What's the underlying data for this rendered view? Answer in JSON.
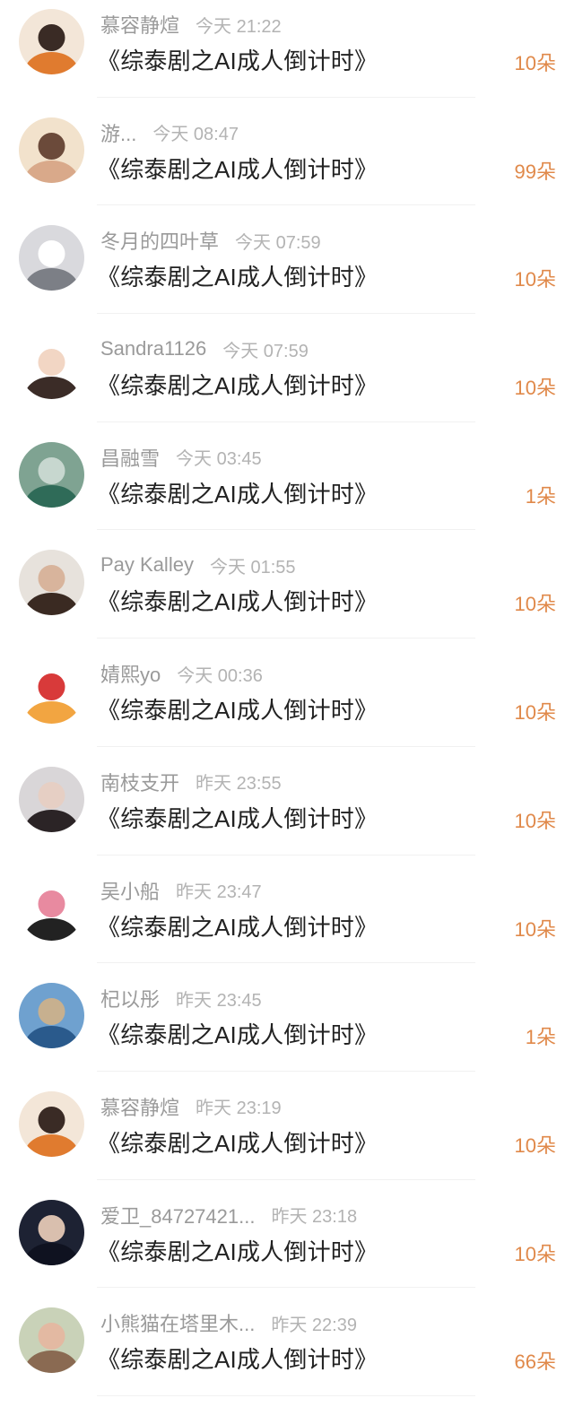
{
  "entries": [
    {
      "name": "慕容静煊",
      "time": "今天 21:22",
      "title": "《综泰剧之AI成人倒计时》",
      "amount": "10朵",
      "avatar_icon": "girl-in-orange-avatar-icon",
      "avatar_colors": [
        "#f3e6d8",
        "#e07b2f",
        "#3a2b25"
      ]
    },
    {
      "name": "游...",
      "time": "今天 08:47",
      "title": "《综泰剧之AI成人倒计时》",
      "amount": "99朵",
      "avatar_icon": "girl-portrait-avatar-icon",
      "avatar_colors": [
        "#f2e2cc",
        "#d9a98a",
        "#6b4a3a"
      ]
    },
    {
      "name": "冬月的四叶草",
      "time": "今天 07:59",
      "title": "《综泰剧之AI成人倒计时》",
      "amount": "10朵",
      "avatar_icon": "cat-avatar-icon",
      "avatar_colors": [
        "#d9d9dd",
        "#7c7f86",
        "#ffffff"
      ]
    },
    {
      "name": "Sandra1126",
      "time": "今天 07:59",
      "title": "《综泰剧之AI成人倒计时》",
      "amount": "10朵",
      "avatar_icon": "cartoon-boy-avatar-icon",
      "avatar_colors": [
        "#ffffff",
        "#3b2c27",
        "#f2d6c4"
      ]
    },
    {
      "name": "昌融雪",
      "time": "今天 03:45",
      "title": "《综泰剧之AI成人倒计时》",
      "amount": "1朵",
      "avatar_icon": "lake-landscape-avatar-icon",
      "avatar_colors": [
        "#7fa392",
        "#2f6b58",
        "#c7d7cf"
      ]
    },
    {
      "name": "Pay Kalley",
      "time": "今天 01:55",
      "title": "《综泰剧之AI成人倒计时》",
      "amount": "10朵",
      "avatar_icon": "girl-photo-avatar-icon",
      "avatar_colors": [
        "#e7e2dc",
        "#3a2a22",
        "#d8b49c"
      ]
    },
    {
      "name": "婧熙yo",
      "time": "今天 00:36",
      "title": "《综泰剧之AI成人倒计时》",
      "amount": "10朵",
      "avatar_icon": "cartoon-dragon-avatar-icon",
      "avatar_colors": [
        "#ffffff",
        "#f2a541",
        "#d83a3a"
      ]
    },
    {
      "name": "南枝支开",
      "time": "昨天 23:55",
      "title": "《综泰剧之AI成人倒计时》",
      "amount": "10朵",
      "avatar_icon": "man-portrait-avatar-icon",
      "avatar_colors": [
        "#d9d6d8",
        "#2b2426",
        "#e6cfc4"
      ]
    },
    {
      "name": "吴小船",
      "time": "昨天 23:47",
      "title": "《综泰剧之AI成人倒计时》",
      "amount": "10朵",
      "avatar_icon": "cartoon-character-avatar-icon",
      "avatar_colors": [
        "#ffffff",
        "#222222",
        "#e88aa0"
      ]
    },
    {
      "name": "杞以彤",
      "time": "昨天 23:45",
      "title": "《综泰剧之AI成人倒计时》",
      "amount": "1朵",
      "avatar_icon": "mountain-lake-avatar-icon",
      "avatar_colors": [
        "#6fa1cf",
        "#2a5a8c",
        "#c7b08f"
      ]
    },
    {
      "name": "慕容静煊",
      "time": "昨天 23:19",
      "title": "《综泰剧之AI成人倒计时》",
      "amount": "10朵",
      "avatar_icon": "girl-in-orange-avatar-icon",
      "avatar_colors": [
        "#f3e6d8",
        "#e07b2f",
        "#3a2b25"
      ]
    },
    {
      "name": "爱卫_84727421...",
      "time": "昨天 23:18",
      "title": "《综泰剧之AI成人倒计时》",
      "amount": "10朵",
      "avatar_icon": "man-dark-portrait-avatar-icon",
      "avatar_colors": [
        "#1d2233",
        "#0f1220",
        "#d9bfae"
      ]
    },
    {
      "name": "小熊猫在塔里木...",
      "time": "昨天 22:39",
      "title": "《综泰剧之AI成人倒计时》",
      "amount": "66朵",
      "avatar_icon": "baby-photo-avatar-icon",
      "avatar_colors": [
        "#c9d2b8",
        "#8a6a52",
        "#e3b9a2"
      ]
    }
  ]
}
